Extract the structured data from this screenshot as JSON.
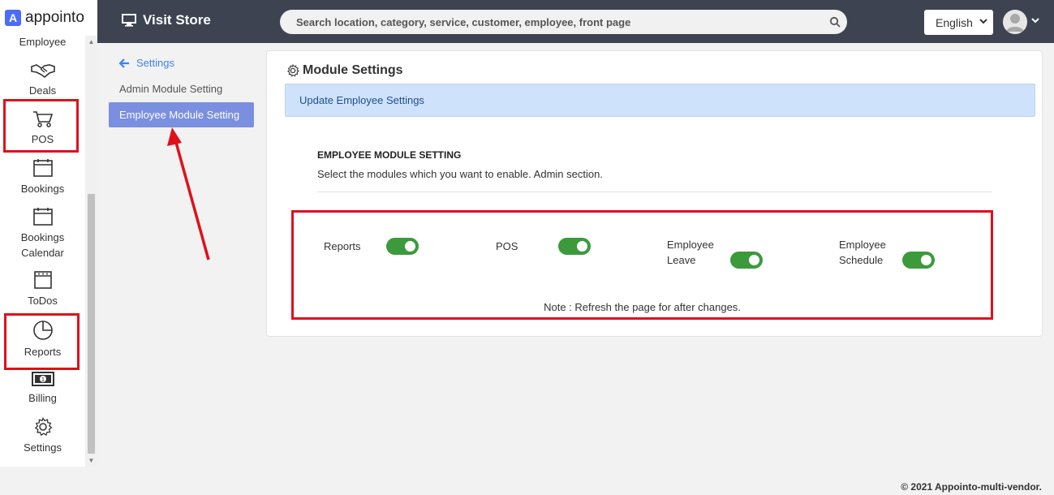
{
  "brand": {
    "name": "appointo",
    "mark": "A"
  },
  "sidebar": {
    "items": [
      {
        "label": "Employee"
      },
      {
        "label": "Deals"
      },
      {
        "label": "POS"
      },
      {
        "label": "Bookings"
      },
      {
        "label": "Bookings Calendar"
      },
      {
        "label": "ToDos"
      },
      {
        "label": "Reports"
      },
      {
        "label": "Billing"
      },
      {
        "label": "Settings"
      }
    ]
  },
  "topbar": {
    "visit_store": "Visit Store",
    "search_placeholder": "Search location, category, service, customer, employee, front page",
    "language": "English"
  },
  "settings_nav": {
    "back_label": "Settings",
    "items": [
      {
        "label": "Admin Module Setting",
        "active": false
      },
      {
        "label": "Employee Module Setting",
        "active": true
      }
    ]
  },
  "card": {
    "title": "Module Settings",
    "alert": "Update Employee Settings",
    "section_heading": "EMPLOYEE MODULE SETTING",
    "section_sub": "Select the modules which you want to enable. Admin section.",
    "modules": [
      {
        "label": "Reports",
        "enabled": true
      },
      {
        "label": "POS",
        "enabled": true
      },
      {
        "label_line1": "Employee",
        "label_line2": "Leave",
        "enabled": true
      },
      {
        "label_line1": "Employee",
        "label_line2": "Schedule",
        "enabled": true
      }
    ],
    "note": "Note : Refresh the page for after changes."
  },
  "colors": {
    "accent": "#7b8fe0",
    "toggle_on": "#3c9a3c",
    "topbar": "#3d4350",
    "highlight": "#e0101b"
  },
  "footer": "© 2021 Appointo-multi-vendor."
}
